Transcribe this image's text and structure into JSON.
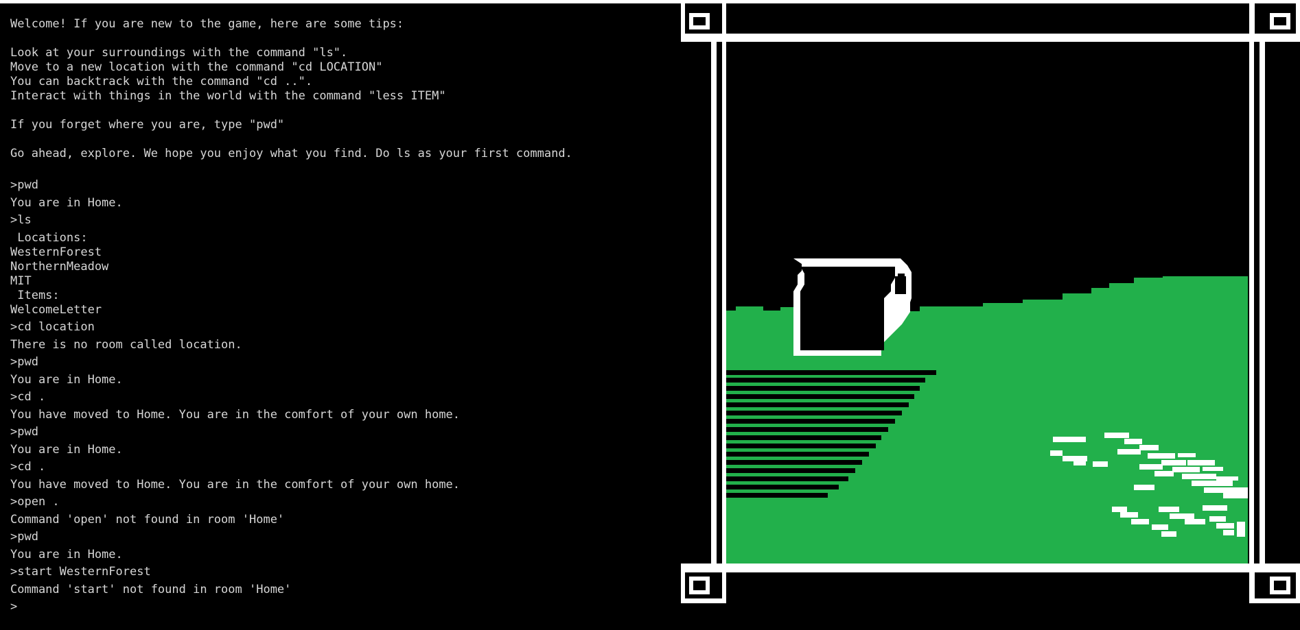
{
  "terminal": {
    "lines": [
      "Welcome! If you are new to the game, here are some tips:",
      "Look at your surroundings with the command \"ls\".",
      "Move to a new location with the command \"cd LOCATION\"",
      "You can backtrack with the command \"cd ..\".",
      "Interact with things in the world with the command \"less ITEM\"",
      "If you forget where you are, type \"pwd\"",
      "Go ahead, explore. We hope you enjoy what you find. Do ls as your first command.",
      ">pwd",
      "You are in Home.",
      ">ls",
      " Locations:",
      "WesternForest",
      "NorthernMeadow",
      "MIT",
      " Items:",
      "WelcomeLetter",
      ">cd location",
      "There is no room called location.",
      ">pwd",
      "You are in Home.",
      ">cd .",
      "You have moved to Home. You are in the comfort of your own home.",
      ">pwd",
      "You are in Home.",
      ">cd .",
      "You have moved to Home. You are in the comfort of your own home.",
      ">open .",
      "Command 'open' not found in room 'Home'",
      ">pwd",
      "You are in Home.",
      ">start WesternForest",
      "Command 'start' not found in room 'Home'",
      ">"
    ]
  },
  "colors": {
    "background": "#000000",
    "terminal_text": "#d7d7d7",
    "frame": "#ffffff",
    "grass": "#22b04b"
  },
  "scene": {
    "description_icon": "pixel-art-home-scene"
  }
}
